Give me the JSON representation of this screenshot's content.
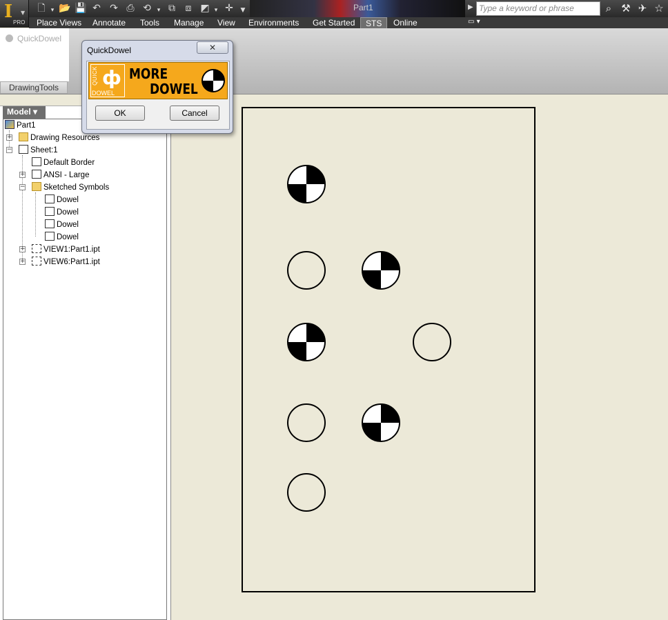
{
  "titlebar": {
    "doc_title": "Part1",
    "search_placeholder": "Type a keyword or phrase",
    "app_badge": "PRO"
  },
  "tabs": [
    "Place Views",
    "Annotate",
    "Tools",
    "Manage",
    "View",
    "Environments",
    "Get Started",
    "STS",
    "Online"
  ],
  "ribbon": {
    "quickdowel_button": "QuickDowel",
    "panel_label": "DrawingTools"
  },
  "browser": {
    "model_tab": "Model ▾",
    "tree": {
      "root": "Part1",
      "drawing_resources": "Drawing Resources",
      "sheet": "Sheet:1",
      "default_border": "Default Border",
      "ansi": "ANSI - Large",
      "sketched_symbols": "Sketched Symbols",
      "dowels": [
        "Dowel",
        "Dowel",
        "Dowel",
        "Dowel"
      ],
      "view1": "VIEW1:Part1.ipt",
      "view6": "VIEW6:Part1.ipt"
    }
  },
  "dialog": {
    "title": "QuickDowel",
    "close": "✕",
    "banner_line1": "MORE",
    "banner_line2": "DOWEL",
    "banner_quick": "QUICK",
    "banner_dowel": "DOWEL",
    "ok": "OK",
    "cancel": "Cancel"
  },
  "colors": {
    "banner_orange": "#f5a81c",
    "sheet_bg": "#ece9d8",
    "dark_bar": "#2a2a2a"
  },
  "dowels": [
    {
      "type": "symbol",
      "row": 1,
      "col": 1
    },
    {
      "type": "hole",
      "row": 2,
      "col": 1
    },
    {
      "type": "symbol",
      "row": 2,
      "col": 2
    },
    {
      "type": "symbol",
      "row": 3,
      "col": 1
    },
    {
      "type": "hole",
      "row": 3,
      "col": 3
    },
    {
      "type": "hole",
      "row": 4,
      "col": 1
    },
    {
      "type": "symbol",
      "row": 4,
      "col": 2
    },
    {
      "type": "hole",
      "row": 5,
      "col": 1
    }
  ]
}
